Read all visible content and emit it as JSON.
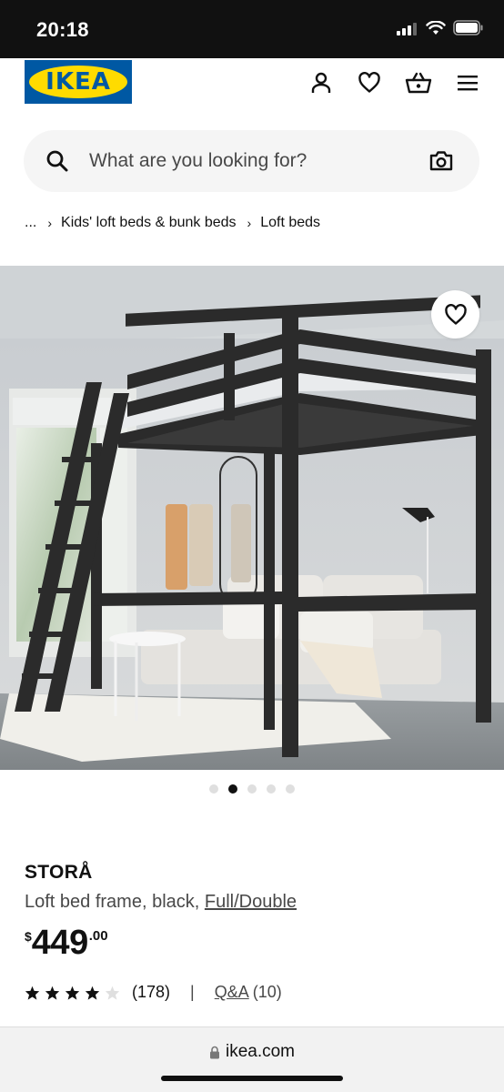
{
  "status_bar": {
    "time": "20:18"
  },
  "header": {
    "logo_text": "IKEA",
    "icons": [
      "user-icon",
      "heart-icon",
      "basket-icon",
      "menu-icon"
    ]
  },
  "search": {
    "placeholder": "What are you looking for?"
  },
  "breadcrumb": {
    "ellipsis": "...",
    "items": [
      "Kids' loft beds & bunk beds",
      "Loft beds"
    ]
  },
  "carousel": {
    "count": 5,
    "active_index": 1
  },
  "product": {
    "name": "STORÅ",
    "description": "Loft bed frame, black,",
    "size_link": "Full/Double",
    "price": {
      "currency": "$",
      "integer": "449",
      "decimals": ".00"
    },
    "rating": {
      "stars": 4,
      "max": 5,
      "count": "(178)"
    },
    "divider": "|",
    "qa_label": "Q&A",
    "qa_count": "(10)"
  },
  "browser": {
    "url": "ikea.com"
  },
  "colors": {
    "ikea_blue": "#0058a3",
    "ikea_yellow": "#ffdb00"
  }
}
